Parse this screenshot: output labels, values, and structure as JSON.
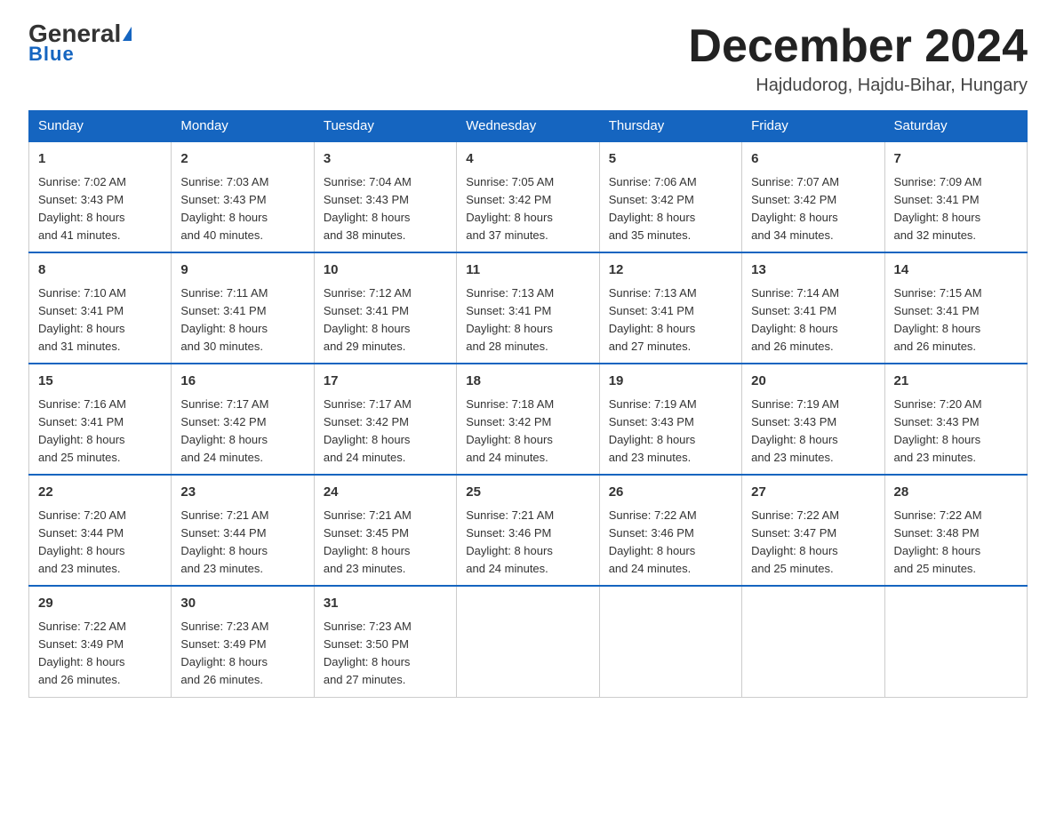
{
  "header": {
    "logo_general": "General",
    "logo_blue": "Blue",
    "month_title": "December 2024",
    "location": "Hajdudorog, Hajdu-Bihar, Hungary"
  },
  "days_of_week": [
    "Sunday",
    "Monday",
    "Tuesday",
    "Wednesday",
    "Thursday",
    "Friday",
    "Saturday"
  ],
  "weeks": [
    [
      {
        "day": "1",
        "sunrise": "7:02 AM",
        "sunset": "3:43 PM",
        "daylight": "8 hours and 41 minutes."
      },
      {
        "day": "2",
        "sunrise": "7:03 AM",
        "sunset": "3:43 PM",
        "daylight": "8 hours and 40 minutes."
      },
      {
        "day": "3",
        "sunrise": "7:04 AM",
        "sunset": "3:43 PM",
        "daylight": "8 hours and 38 minutes."
      },
      {
        "day": "4",
        "sunrise": "7:05 AM",
        "sunset": "3:42 PM",
        "daylight": "8 hours and 37 minutes."
      },
      {
        "day": "5",
        "sunrise": "7:06 AM",
        "sunset": "3:42 PM",
        "daylight": "8 hours and 35 minutes."
      },
      {
        "day": "6",
        "sunrise": "7:07 AM",
        "sunset": "3:42 PM",
        "daylight": "8 hours and 34 minutes."
      },
      {
        "day": "7",
        "sunrise": "7:09 AM",
        "sunset": "3:41 PM",
        "daylight": "8 hours and 32 minutes."
      }
    ],
    [
      {
        "day": "8",
        "sunrise": "7:10 AM",
        "sunset": "3:41 PM",
        "daylight": "8 hours and 31 minutes."
      },
      {
        "day": "9",
        "sunrise": "7:11 AM",
        "sunset": "3:41 PM",
        "daylight": "8 hours and 30 minutes."
      },
      {
        "day": "10",
        "sunrise": "7:12 AM",
        "sunset": "3:41 PM",
        "daylight": "8 hours and 29 minutes."
      },
      {
        "day": "11",
        "sunrise": "7:13 AM",
        "sunset": "3:41 PM",
        "daylight": "8 hours and 28 minutes."
      },
      {
        "day": "12",
        "sunrise": "7:13 AM",
        "sunset": "3:41 PM",
        "daylight": "8 hours and 27 minutes."
      },
      {
        "day": "13",
        "sunrise": "7:14 AM",
        "sunset": "3:41 PM",
        "daylight": "8 hours and 26 minutes."
      },
      {
        "day": "14",
        "sunrise": "7:15 AM",
        "sunset": "3:41 PM",
        "daylight": "8 hours and 26 minutes."
      }
    ],
    [
      {
        "day": "15",
        "sunrise": "7:16 AM",
        "sunset": "3:41 PM",
        "daylight": "8 hours and 25 minutes."
      },
      {
        "day": "16",
        "sunrise": "7:17 AM",
        "sunset": "3:42 PM",
        "daylight": "8 hours and 24 minutes."
      },
      {
        "day": "17",
        "sunrise": "7:17 AM",
        "sunset": "3:42 PM",
        "daylight": "8 hours and 24 minutes."
      },
      {
        "day": "18",
        "sunrise": "7:18 AM",
        "sunset": "3:42 PM",
        "daylight": "8 hours and 24 minutes."
      },
      {
        "day": "19",
        "sunrise": "7:19 AM",
        "sunset": "3:43 PM",
        "daylight": "8 hours and 23 minutes."
      },
      {
        "day": "20",
        "sunrise": "7:19 AM",
        "sunset": "3:43 PM",
        "daylight": "8 hours and 23 minutes."
      },
      {
        "day": "21",
        "sunrise": "7:20 AM",
        "sunset": "3:43 PM",
        "daylight": "8 hours and 23 minutes."
      }
    ],
    [
      {
        "day": "22",
        "sunrise": "7:20 AM",
        "sunset": "3:44 PM",
        "daylight": "8 hours and 23 minutes."
      },
      {
        "day": "23",
        "sunrise": "7:21 AM",
        "sunset": "3:44 PM",
        "daylight": "8 hours and 23 minutes."
      },
      {
        "day": "24",
        "sunrise": "7:21 AM",
        "sunset": "3:45 PM",
        "daylight": "8 hours and 23 minutes."
      },
      {
        "day": "25",
        "sunrise": "7:21 AM",
        "sunset": "3:46 PM",
        "daylight": "8 hours and 24 minutes."
      },
      {
        "day": "26",
        "sunrise": "7:22 AM",
        "sunset": "3:46 PM",
        "daylight": "8 hours and 24 minutes."
      },
      {
        "day": "27",
        "sunrise": "7:22 AM",
        "sunset": "3:47 PM",
        "daylight": "8 hours and 25 minutes."
      },
      {
        "day": "28",
        "sunrise": "7:22 AM",
        "sunset": "3:48 PM",
        "daylight": "8 hours and 25 minutes."
      }
    ],
    [
      {
        "day": "29",
        "sunrise": "7:22 AM",
        "sunset": "3:49 PM",
        "daylight": "8 hours and 26 minutes."
      },
      {
        "day": "30",
        "sunrise": "7:23 AM",
        "sunset": "3:49 PM",
        "daylight": "8 hours and 26 minutes."
      },
      {
        "day": "31",
        "sunrise": "7:23 AM",
        "sunset": "3:50 PM",
        "daylight": "8 hours and 27 minutes."
      },
      null,
      null,
      null,
      null
    ]
  ],
  "labels": {
    "sunrise_prefix": "Sunrise: ",
    "sunset_prefix": "Sunset: ",
    "daylight_prefix": "Daylight: "
  }
}
